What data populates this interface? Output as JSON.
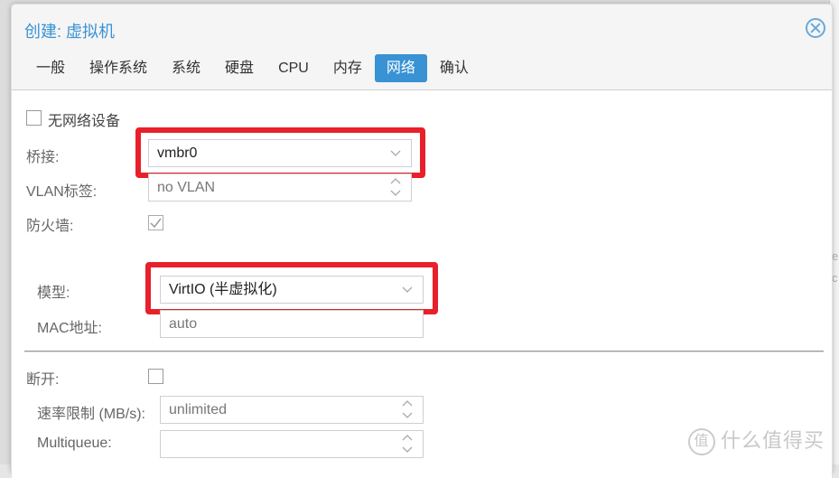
{
  "window": {
    "title": "创建: 虚拟机",
    "close_icon": "close-circle-icon"
  },
  "tabs": [
    {
      "label": "一般",
      "active": false
    },
    {
      "label": "操作系统",
      "active": false
    },
    {
      "label": "系统",
      "active": false
    },
    {
      "label": "硬盘",
      "active": false
    },
    {
      "label": "CPU",
      "active": false
    },
    {
      "label": "内存",
      "active": false
    },
    {
      "label": "网络",
      "active": true
    },
    {
      "label": "确认",
      "active": false
    }
  ],
  "form": {
    "no_network_device": {
      "label": "无网络设备",
      "checked": false
    },
    "bridge": {
      "label": "桥接:",
      "value": "vmbr0",
      "icon": "chevron-down-icon"
    },
    "vlan_tag": {
      "label": "VLAN标签:",
      "placeholder": "no VLAN",
      "icon": "spinner-icon"
    },
    "firewall": {
      "label": "防火墙:",
      "checked": true
    },
    "model": {
      "label": "模型:",
      "value": "VirtIO (半虚拟化)",
      "icon": "chevron-down-icon"
    },
    "mac_address": {
      "label": "MAC地址:",
      "placeholder": "auto"
    },
    "disconnect": {
      "label": "断开:",
      "checked": false
    },
    "rate_limit": {
      "label": "速率限制 (MB/s):",
      "placeholder": "unlimited",
      "icon": "spinner-icon"
    },
    "multiqueue": {
      "label": "Multiqueue:",
      "value": "",
      "icon": "spinner-icon"
    }
  },
  "annotations": {
    "highlight_color": "#e8202a"
  },
  "colors": {
    "accent": "#3892d4",
    "active_tab_text": "#ffffff"
  },
  "watermark": {
    "icon_text": "值",
    "text": "什么值得买"
  },
  "background_ghost": {
    "line1": "e",
    "line2": "c"
  }
}
